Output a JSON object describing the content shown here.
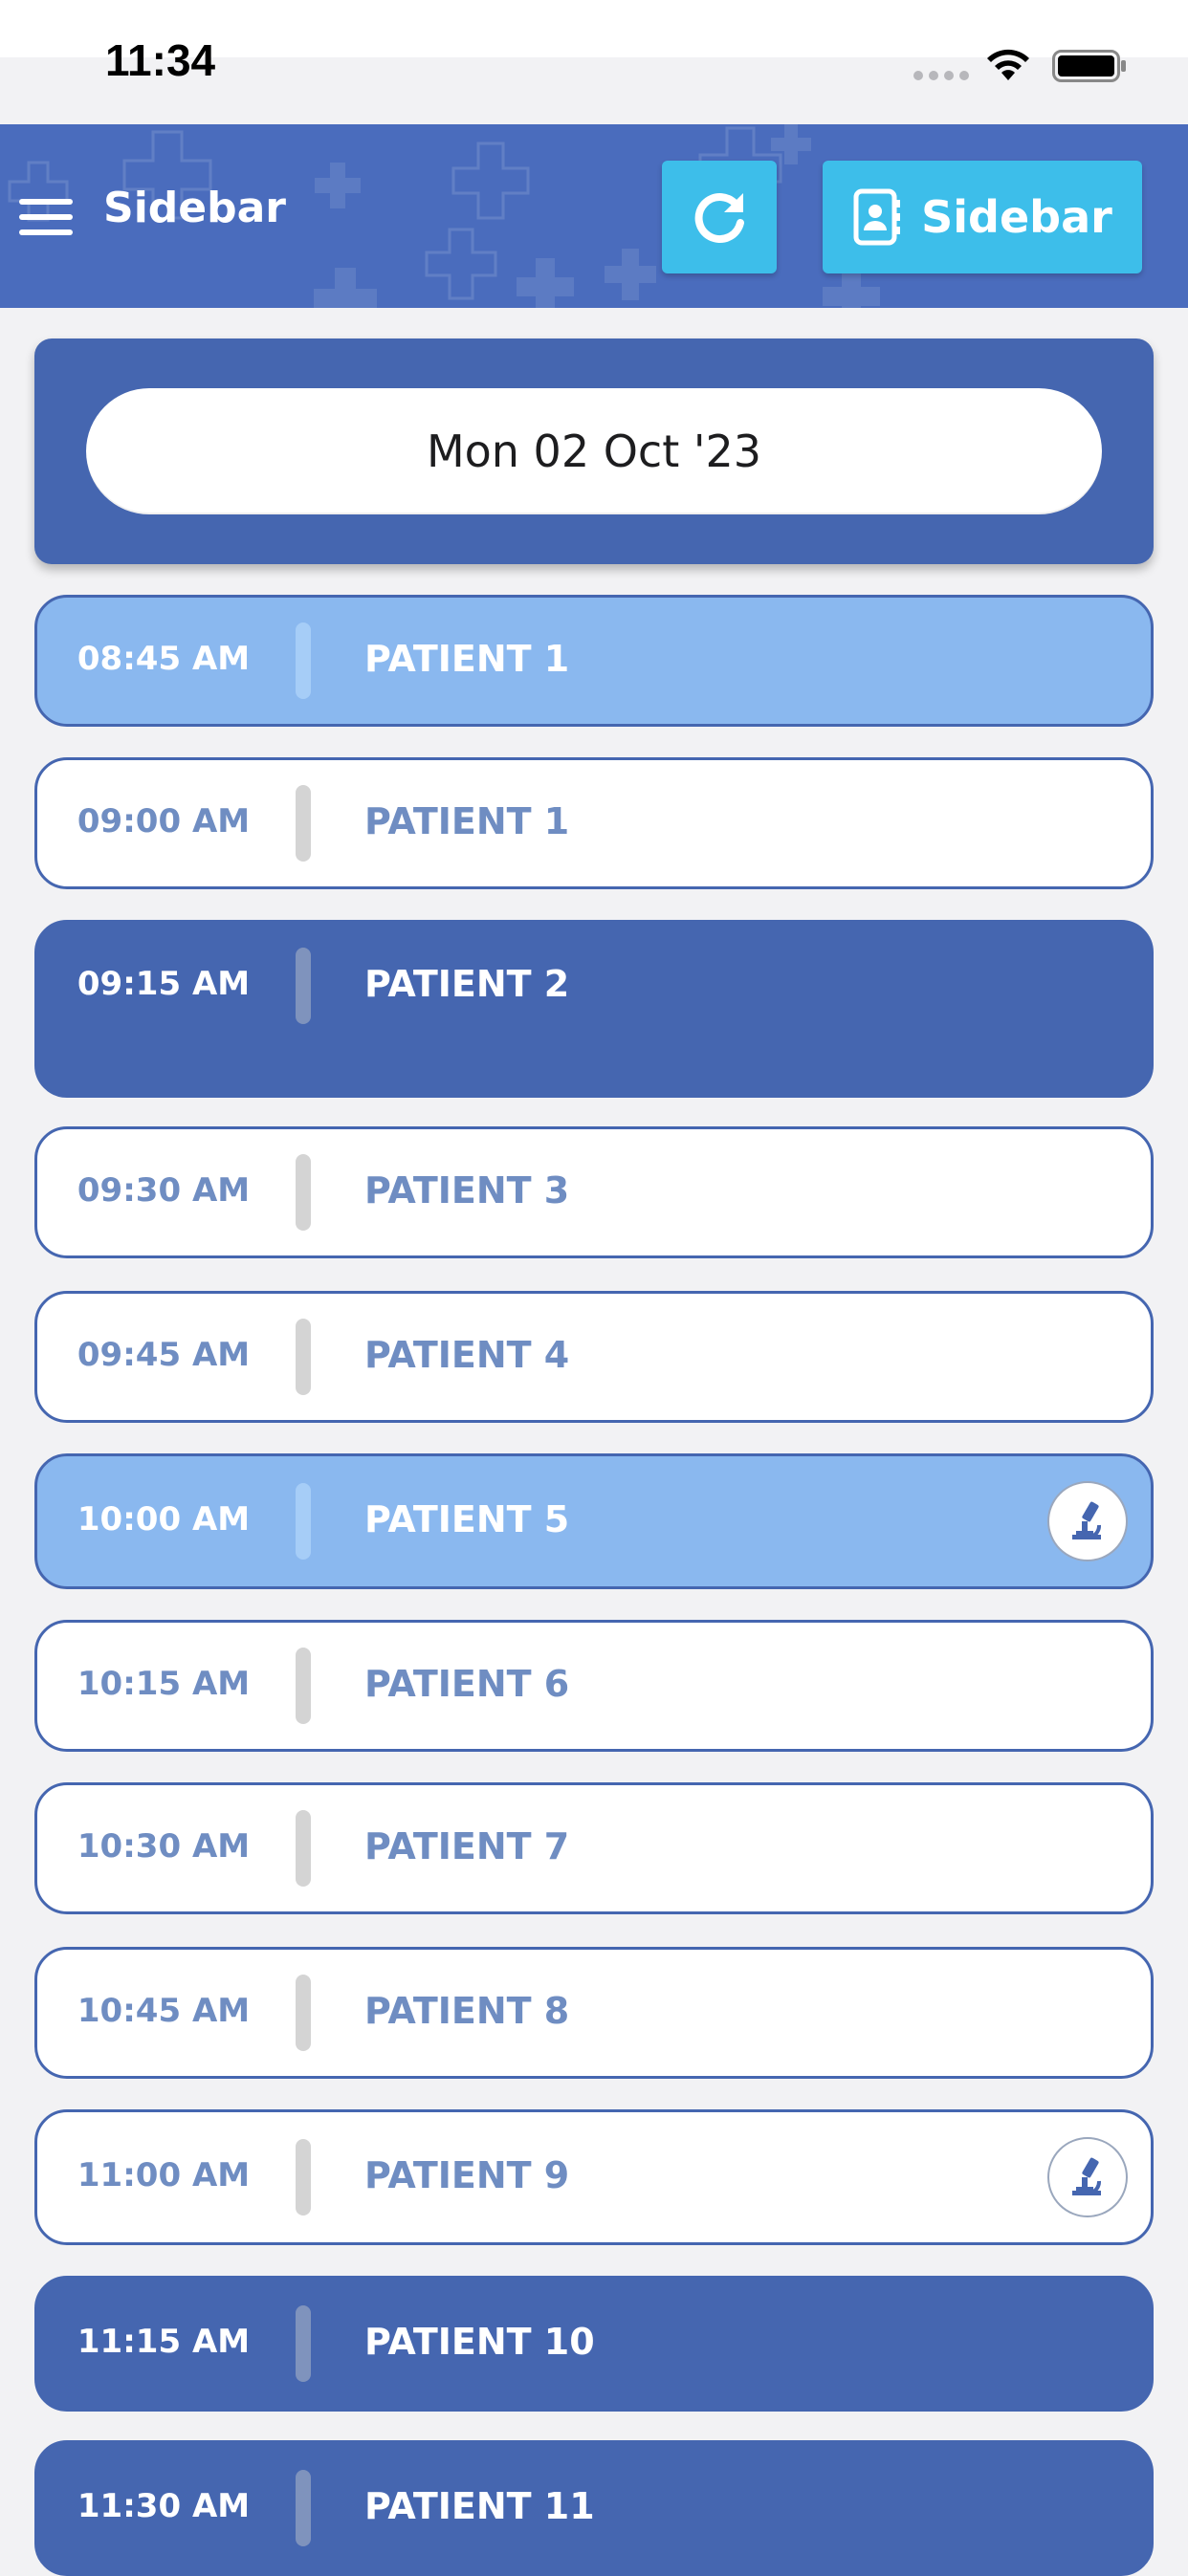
{
  "status_bar": {
    "time": "11:34"
  },
  "header": {
    "title": "Sidebar",
    "sidebar_button_label": "Sidebar",
    "icons": {
      "menu": "hamburger-icon",
      "refresh": "refresh-icon",
      "contacts": "contact-book-icon"
    }
  },
  "date_selector": {
    "value": "Mon 02 Oct '23"
  },
  "colors": {
    "header": "#4a6cbd",
    "accent_button": "#3dbeea",
    "appointment_dark": "#4566b0",
    "appointment_light": "#8ab8ef",
    "appointment_white_text": "#6f8dc2"
  },
  "appointments": [
    {
      "time": "08:45 AM",
      "patient": "PATIENT 1",
      "style": "light",
      "lab_icon": false
    },
    {
      "time": "09:00 AM",
      "patient": "PATIENT 1",
      "style": "white",
      "lab_icon": false
    },
    {
      "time": "09:15 AM",
      "patient": "PATIENT 2",
      "style": "dark",
      "lab_icon": false
    },
    {
      "time": "09:30 AM",
      "patient": "PATIENT 3",
      "style": "white",
      "lab_icon": false
    },
    {
      "time": "09:45 AM",
      "patient": "PATIENT 4",
      "style": "white",
      "lab_icon": false
    },
    {
      "time": "10:00 AM",
      "patient": "PATIENT 5",
      "style": "light",
      "lab_icon": true
    },
    {
      "time": "10:15 AM",
      "patient": "PATIENT 6",
      "style": "white",
      "lab_icon": false
    },
    {
      "time": "10:30 AM",
      "patient": "PATIENT 7",
      "style": "white",
      "lab_icon": false
    },
    {
      "time": "10:45 AM",
      "patient": "PATIENT 8",
      "style": "white",
      "lab_icon": false
    },
    {
      "time": "11:00 AM",
      "patient": "PATIENT 9",
      "style": "white",
      "lab_icon": true
    },
    {
      "time": "11:15 AM",
      "patient": "PATIENT 10",
      "style": "dark",
      "lab_icon": false
    },
    {
      "time": "11:30 AM",
      "patient": "PATIENT 11",
      "style": "dark",
      "lab_icon": false
    }
  ]
}
